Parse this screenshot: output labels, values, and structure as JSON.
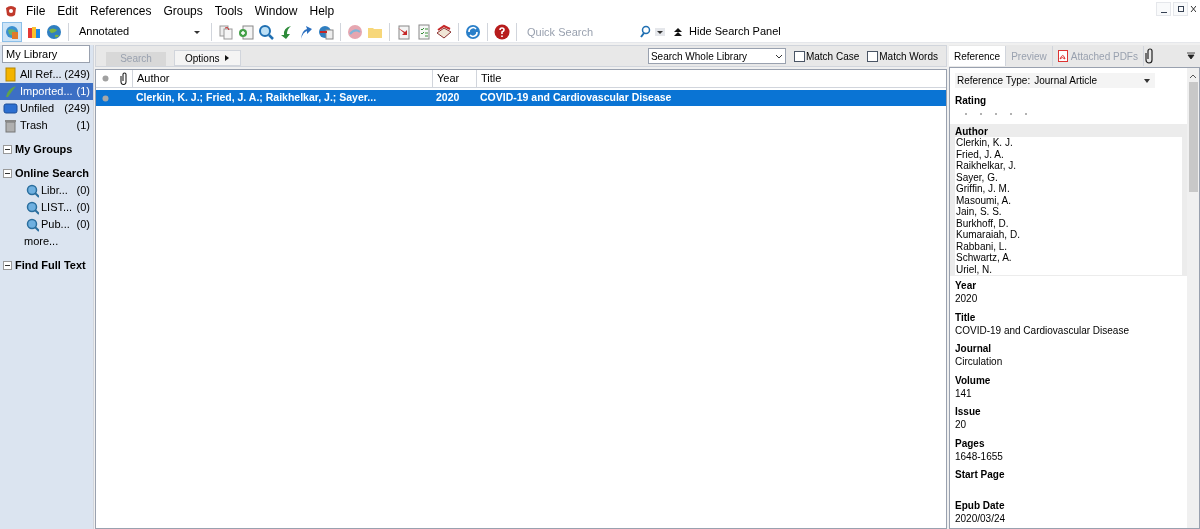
{
  "menu": [
    "File",
    "Edit",
    "References",
    "Groups",
    "Tools",
    "Window",
    "Help"
  ],
  "toolbar": {
    "style": "Annotated",
    "quick_search": {
      "placeholder": "Quick Search"
    },
    "hide_panel": "Hide Search Panel"
  },
  "sidebar": {
    "library_field": "My Library",
    "items": [
      {
        "label": "All Ref...",
        "count": "(249)",
        "kind": "all",
        "selected": false
      },
      {
        "label": "Imported...",
        "count": "(1)",
        "kind": "imported",
        "selected": true
      },
      {
        "label": "Unfiled",
        "count": "(249)",
        "kind": "unfiled",
        "selected": false
      },
      {
        "label": "Trash",
        "count": "(1)",
        "kind": "trash",
        "selected": false
      }
    ],
    "sections": [
      {
        "label": "My Groups",
        "expanded": true
      },
      {
        "label": "Online Search",
        "expanded": true,
        "items": [
          {
            "label": "Libr...",
            "count": "(0)"
          },
          {
            "label": "LIST...",
            "count": "(0)"
          },
          {
            "label": "Pub...",
            "count": "(0)"
          }
        ],
        "more": "more..."
      },
      {
        "label": "Find Full Text",
        "expanded": true
      }
    ]
  },
  "search_panel": {
    "search_button": "Search",
    "options_button": "Options",
    "scope": "Search Whole Library",
    "match_case": {
      "label": "Match Case",
      "checked": false
    },
    "match_words": {
      "label": "Match Words",
      "checked": false
    }
  },
  "table": {
    "columns": [
      "Author",
      "Year",
      "Title"
    ],
    "rows": [
      {
        "author": "Clerkin, K. J.; Fried, J. A.; Raikhelkar, J.; Sayer...",
        "year": "2020",
        "title": "COVID-19 and Cardiovascular Disease",
        "selected": true
      }
    ]
  },
  "reference_panel": {
    "tabs": [
      {
        "label": "Reference",
        "selected": true
      },
      {
        "label": "Preview",
        "selected": false
      },
      {
        "label": "Attached PDFs",
        "selected": false
      }
    ],
    "reference_type_label": "Reference Type:",
    "reference_type": "Journal Article",
    "rating": {
      "label": "Rating",
      "stars": 0
    },
    "author_label": "Author",
    "authors": [
      "Clerkin, K. J.",
      "Fried, J. A.",
      "Raikhelkar, J.",
      "Sayer, G.",
      "Griffin, J. M.",
      "Masoumi, A.",
      "Jain, S. S.",
      "Burkhoff, D.",
      "Kumaraiah, D.",
      "Rabbani, L.",
      "Schwartz, A.",
      "Uriel, N."
    ],
    "fields": [
      {
        "label": "Year",
        "value": "2020"
      },
      {
        "label": "Title",
        "value": "COVID-19 and Cardiovascular Disease"
      },
      {
        "label": "Journal",
        "value": "Circulation"
      },
      {
        "label": "Volume",
        "value": "141"
      },
      {
        "label": "Issue",
        "value": "20"
      },
      {
        "label": "Pages",
        "value": "1648-1655"
      },
      {
        "label": "Start Page"
      },
      {
        "label": "Epub Date",
        "value": "2020/03/24"
      }
    ]
  }
}
